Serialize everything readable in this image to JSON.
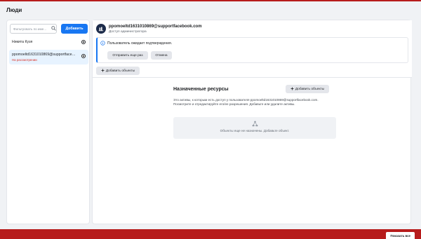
{
  "page": {
    "title": "Люди"
  },
  "sidebar": {
    "filter_placeholder": "Фильтровать по име...",
    "add_label": "Добавить",
    "users": [
      {
        "name": "Никита Кузя",
        "status": "",
        "selected": false
      },
      {
        "name": "ppomoeltd1631010869@supportfaceb...",
        "status": "На рассмотрении",
        "selected": true
      }
    ]
  },
  "user_detail": {
    "email": "ppomoeltd1631010869@supportfacebook.com",
    "role": "Доступ администратора",
    "notice": {
      "text": "Пользователь ожидает подтверждения.",
      "resend_label": "Отправить еще раз",
      "cancel_label": "Отмена"
    },
    "add_objects_label": "Добавить объекты"
  },
  "assigned_resources": {
    "title": "Назначенные ресурсы",
    "add_objects_label": "Добавить объекты",
    "description": "Это активы, к которым есть доступ у пользователя ppomoeltd1631010869@supportfacebook.com. Посмотрите и отредактируйте его/ее разрешения. Добавьте или удалите активы.",
    "empty_text": "Объекты еще не назначены. Добавьте объект."
  },
  "footer": {
    "show_all_label": "Показать все"
  },
  "colors": {
    "accent": "#1877f2",
    "bar": "#b71c1c",
    "pending": "#d93025"
  }
}
